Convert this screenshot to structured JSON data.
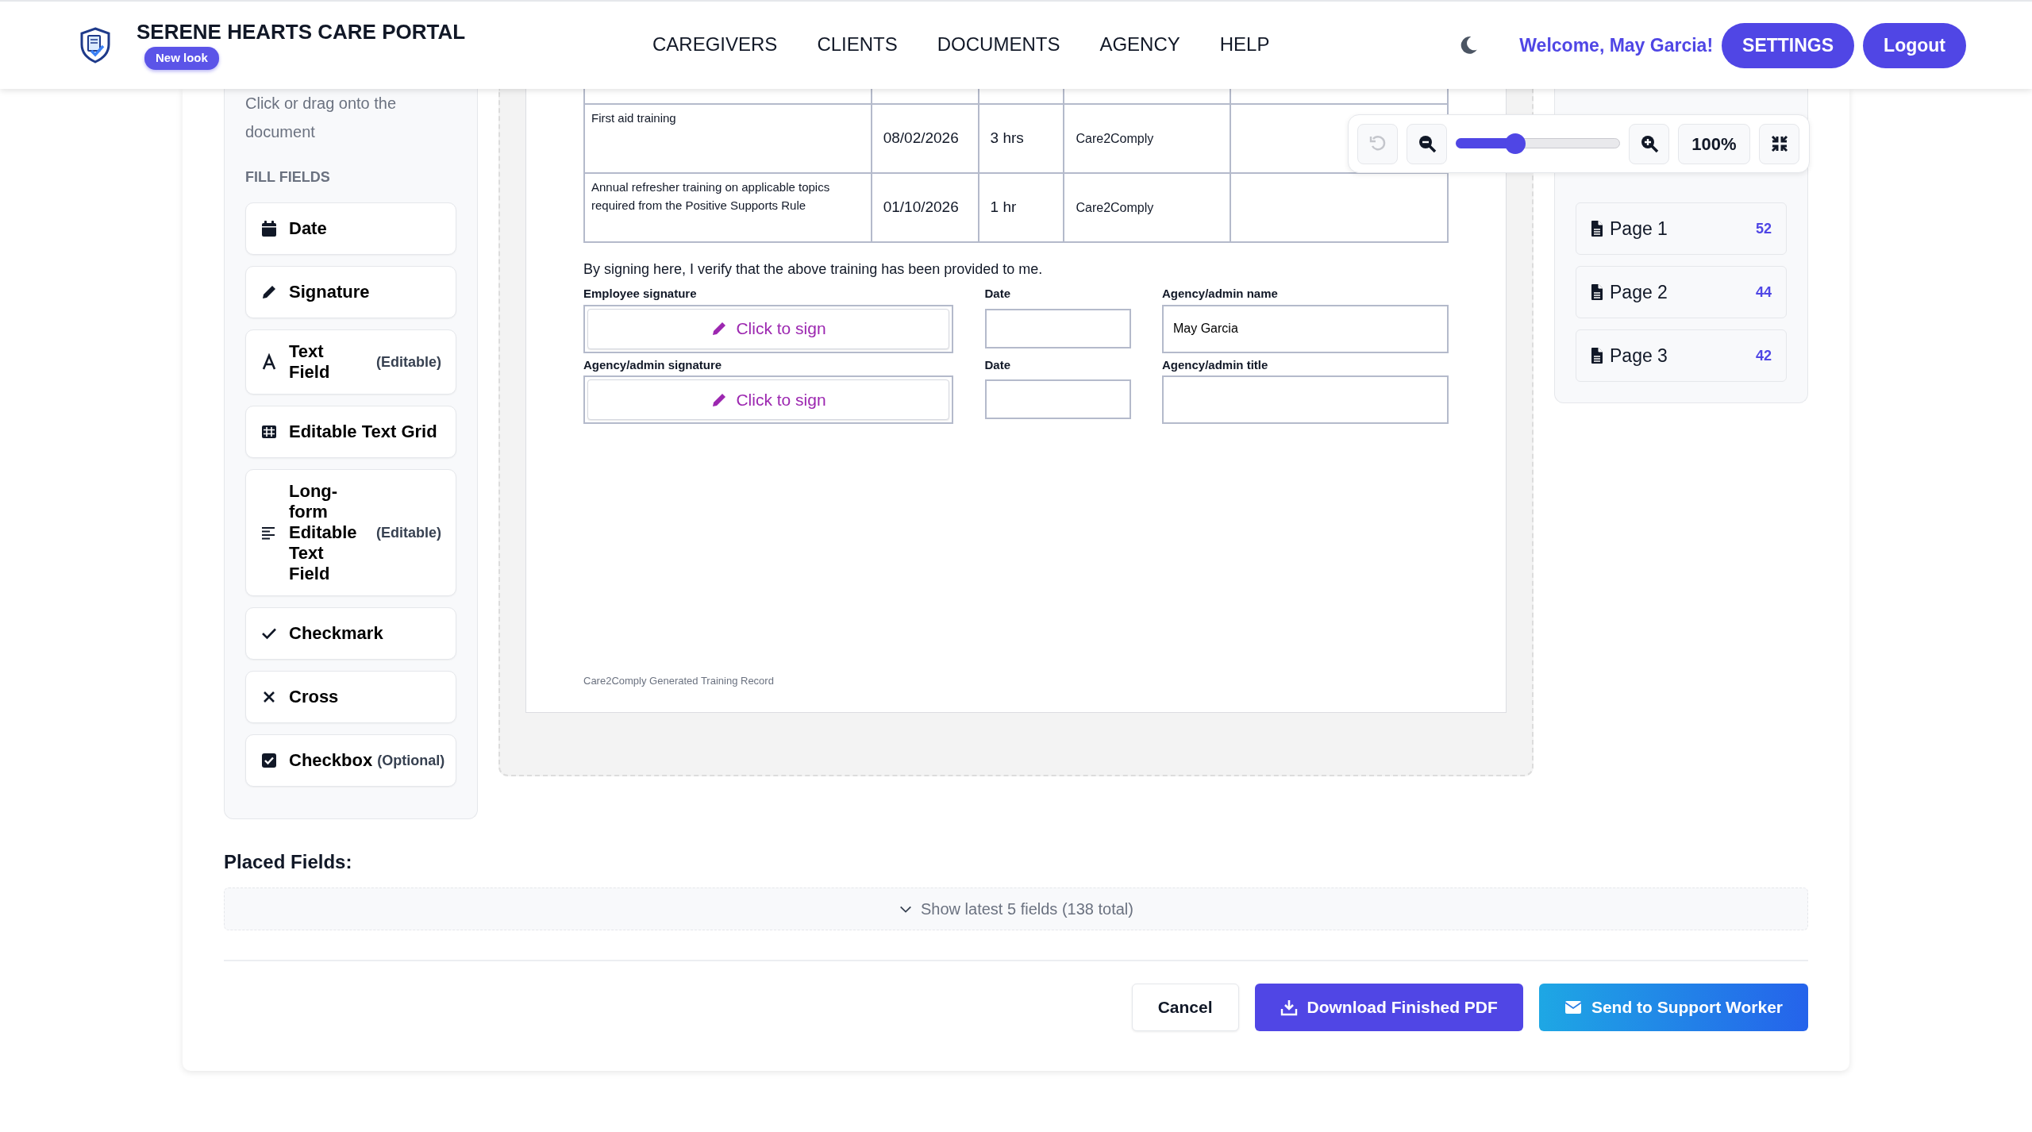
{
  "header": {
    "title": "SERENE HEARTS CARE PORTAL",
    "badge": "New look",
    "nav": [
      {
        "label": "CAREGIVERS",
        "selected": false
      },
      {
        "label": "CLIENTS",
        "selected": false
      },
      {
        "label": "DOCUMENTS",
        "selected": false
      },
      {
        "label": "AGENCY",
        "selected": false
      },
      {
        "label": "HELP",
        "selected": false
      }
    ],
    "welcome": "Welcome, May Garcia!",
    "buttons": [
      {
        "label": "SETTINGS"
      },
      {
        "label": "Logout"
      }
    ]
  },
  "tools": {
    "hint": "Click or drag onto the document",
    "section": "FILL FIELDS",
    "items": [
      {
        "kind": "date",
        "label": "Date"
      },
      {
        "kind": "signature",
        "label": "Signature"
      },
      {
        "kind": "text",
        "label": "Text Field",
        "note": "(Editable)"
      },
      {
        "kind": "grid",
        "label": "Editable Text Grid"
      },
      {
        "kind": "longform",
        "label": "Long-form Editable Text Field",
        "note": "(Editable)"
      },
      {
        "kind": "checkmark",
        "label": "Checkmark"
      },
      {
        "kind": "cross",
        "label": "Cross"
      },
      {
        "kind": "checkbox",
        "label": "Checkbox",
        "note": "(Optional)"
      }
    ]
  },
  "document": {
    "rows": [
      {
        "description": "First aid training",
        "date": "08/02/2026",
        "duration": "3 hrs",
        "provider": "Care2Comply"
      },
      {
        "description": "Annual refresher training on applicable topics required from the Positive Supports Rule",
        "date": "01/10/2026",
        "duration": "1 hr",
        "provider": "Care2Comply"
      }
    ],
    "statement": "By signing here, I verify that the above training has been provided to me.",
    "fields": [
      {
        "kind": "signature",
        "label": "Employee signature",
        "button": "Click to sign"
      },
      {
        "kind": "input",
        "label": "Date"
      },
      {
        "kind": "input",
        "label": "Agency/admin name",
        "value": "May Garcia"
      },
      {
        "kind": "signature",
        "label": "Agency/admin signature",
        "button": "Click to sign"
      },
      {
        "kind": "input",
        "label": "Date"
      },
      {
        "kind": "input",
        "label": "Agency/admin title"
      }
    ],
    "footer": "Care2Comply Generated Training Record"
  },
  "zoom_toolbar": {
    "undo": {
      "disabled": true
    },
    "level": 0.36,
    "reading": "100%"
  },
  "pages": [
    {
      "label": "Page 1",
      "count": "52"
    },
    {
      "label": "Page 2",
      "count": "44"
    },
    {
      "label": "Page 3",
      "count": "42"
    }
  ],
  "placed_fields": {
    "title": "Placed Fields:",
    "toggle": "Show latest 5 fields (138 total)"
  },
  "actions": [
    {
      "kind": "cancel",
      "label": "Cancel"
    },
    {
      "kind": "download",
      "label": "Download Finished PDF"
    },
    {
      "kind": "send",
      "label": "Send to Support Worker"
    }
  ]
}
